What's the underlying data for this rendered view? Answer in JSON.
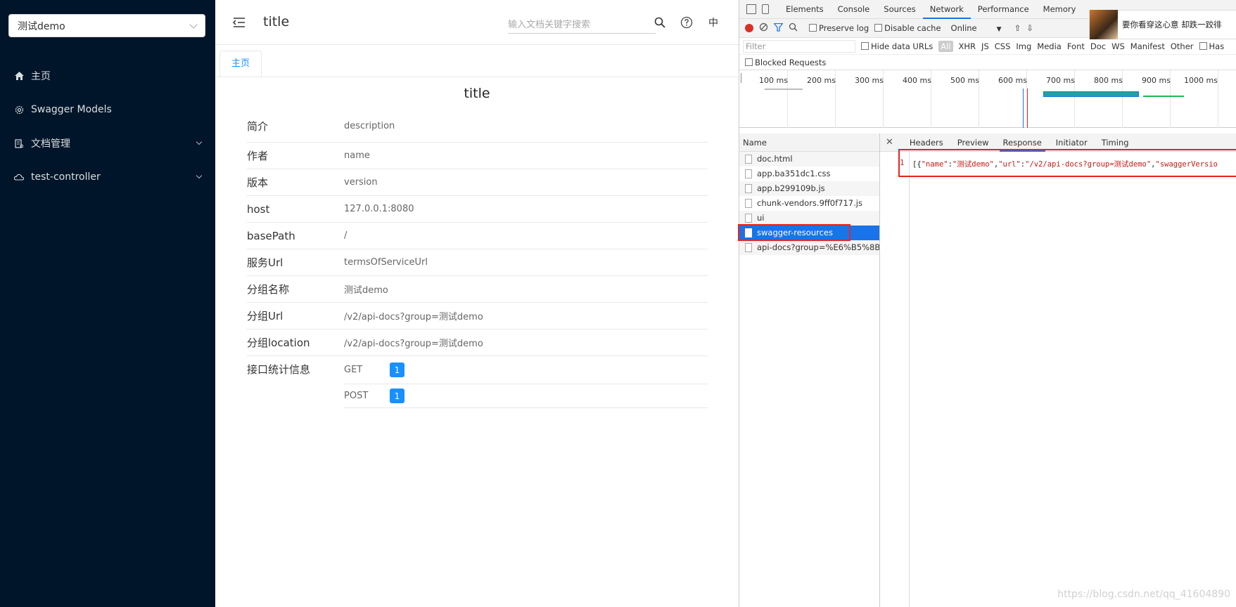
{
  "sidebar": {
    "group_select": "测试demo",
    "items": [
      {
        "label": "主页",
        "icon": "home-icon"
      },
      {
        "label": "Swagger Models",
        "icon": "gear-icon"
      },
      {
        "label": "文档管理",
        "icon": "document-icon"
      },
      {
        "label": "test-controller",
        "icon": "cloud-icon"
      }
    ]
  },
  "header": {
    "title": "title",
    "search_placeholder": "输入文档关键字搜索",
    "lang": "中"
  },
  "tabs": [
    {
      "label": "主页"
    }
  ],
  "doc": {
    "title": "title",
    "rows": [
      {
        "key": "简介",
        "value": "description"
      },
      {
        "key": "作者",
        "value": "name"
      },
      {
        "key": "版本",
        "value": "version"
      },
      {
        "key": "host",
        "value": "127.0.0.1:8080"
      },
      {
        "key": "basePath",
        "value": "/"
      },
      {
        "key": "服务Url",
        "value": "termsOfServiceUrl"
      },
      {
        "key": "分组名称",
        "value": "测试demo"
      },
      {
        "key": "分组Url",
        "value": "/v2/api-docs?group=测试demo"
      },
      {
        "key": "分组location",
        "value": "/v2/api-docs?group=测试demo"
      }
    ],
    "stats_label": "接口统计信息",
    "stats": [
      {
        "method": "GET",
        "count": "1"
      },
      {
        "method": "POST",
        "count": "1"
      }
    ]
  },
  "devtools": {
    "tabs": [
      "Elements",
      "Console",
      "Sources",
      "Network",
      "Performance",
      "Memory"
    ],
    "active_tab": "Network",
    "ad_text": "要你看穿这心意 却跌一跤徘",
    "toolbar": {
      "preserve_log": "Preserve log",
      "disable_cache": "Disable cache",
      "throttle": "Online"
    },
    "filter": {
      "placeholder": "Filter",
      "hide_data_urls": "Hide data URLs",
      "types": [
        "All",
        "XHR",
        "JS",
        "CSS",
        "Img",
        "Media",
        "Font",
        "Doc",
        "WS",
        "Manifest",
        "Other"
      ],
      "has_label": "Has"
    },
    "blocked_requests": "Blocked Requests",
    "timeline_ticks": [
      "100 ms",
      "200 ms",
      "300 ms",
      "400 ms",
      "500 ms",
      "600 ms",
      "700 ms",
      "800 ms",
      "900 ms",
      "1000 ms"
    ],
    "name_header": "Name",
    "requests": [
      "doc.html",
      "app.ba351dc1.css",
      "app.b299109b.js",
      "chunk-vendors.9ff0f717.js",
      "ui",
      "swagger-resources",
      "api-docs?group=%E6%B5%8B..."
    ],
    "selected_request": "swagger-resources",
    "detail_tabs": [
      "Headers",
      "Preview",
      "Response",
      "Initiator",
      "Timing"
    ],
    "active_detail_tab": "Response",
    "response": {
      "line_no": "1",
      "p1": "[{",
      "s1": "\"name\"",
      "p2": ":",
      "s2": "\"测试demo\"",
      "p3": ",",
      "s3": "\"url\"",
      "p4": ":",
      "s4": "\"/v2/api-docs?group=测试demo\"",
      "p5": ",",
      "s5": "\"swaggerVersio"
    }
  },
  "watermark": "https://blog.csdn.net/qq_41604890",
  "colors": {
    "sidebar_bg": "#001529",
    "accent": "#1890ff",
    "devtools_selected": "#1a73e8",
    "highlight_box": "#e8231f"
  }
}
